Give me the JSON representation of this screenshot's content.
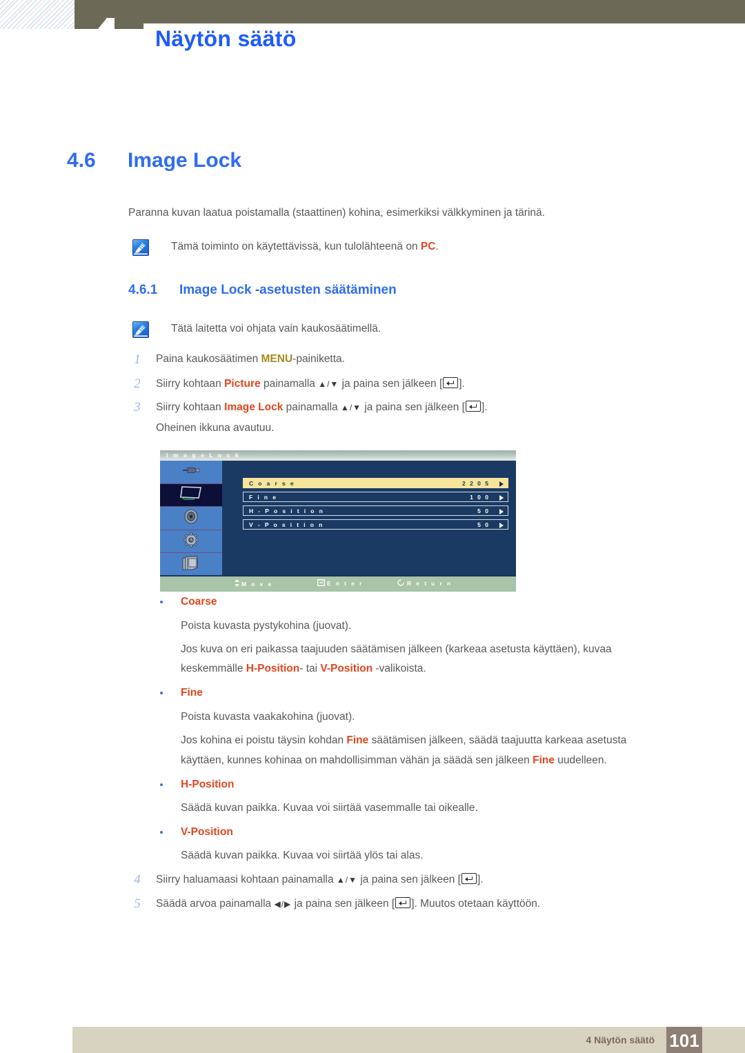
{
  "header": {
    "chapter_number": "4",
    "chapter_title": "Näytön säätö"
  },
  "section": {
    "number": "4.6",
    "title": "Image Lock",
    "intro": "Paranna kuvan laatua poistamalla (staattinen) kohina, esimerkiksi välkkyminen ja tärinä.",
    "note": {
      "icon": "note-pen-icon",
      "text_before": "Tämä toiminto on käytettävissä, kun tulolähteenä on ",
      "highlight": "PC",
      "text_after": "."
    }
  },
  "subsection": {
    "number": "4.6.1",
    "title": "Image Lock -asetusten säätäminen",
    "note": {
      "icon": "note-pen-icon",
      "text": "Tätä laitetta voi ohjata vain kaukosäätimellä."
    }
  },
  "steps_before": [
    {
      "n": "1",
      "parts": [
        {
          "t": "Paina kaukosäätimen ",
          "style": "plain"
        },
        {
          "t": "MENU",
          "style": "mustard"
        },
        {
          "t": "-painiketta.",
          "style": "plain"
        }
      ]
    },
    {
      "n": "2",
      "parts": [
        {
          "t": "Siirry kohtaan ",
          "style": "plain"
        },
        {
          "t": "Picture",
          "style": "orange"
        },
        {
          "t": " painamalla ",
          "style": "plain"
        },
        {
          "t": "▲/▼",
          "style": "arrows"
        },
        {
          "t": " ja paina sen jälkeen [",
          "style": "plain"
        },
        {
          "t": "enter-key-icon",
          "style": "enterkey"
        },
        {
          "t": "].",
          "style": "plain"
        }
      ]
    },
    {
      "n": "3",
      "parts": [
        {
          "t": "Siirry kohtaan ",
          "style": "plain"
        },
        {
          "t": "Image Lock",
          "style": "orange"
        },
        {
          "t": " painamalla ",
          "style": "plain"
        },
        {
          "t": "▲/▼",
          "style": "arrows"
        },
        {
          "t": " ja paina sen jälkeen [",
          "style": "plain"
        },
        {
          "t": "enter-key-icon",
          "style": "enterkey"
        },
        {
          "t": "].",
          "style": "plain"
        }
      ]
    }
  ],
  "step3_followup": "Oheinen ikkuna avautuu.",
  "osd": {
    "title": "I m a g e   L o c k",
    "sidebar_icons": [
      "input-connector-icon",
      "monitor-screen-icon",
      "speaker-icon",
      "gear-setup-icon",
      "multi-screen-icon"
    ],
    "selected_sidebar_index": 1,
    "rows": [
      {
        "label": "C o a r s e",
        "value": "2 2 0 5",
        "highlighted": true
      },
      {
        "label": "F i n e",
        "value": "1 0 0",
        "highlighted": false
      },
      {
        "label": "H - P o s i t i o n",
        "value": "5 0",
        "highlighted": false
      },
      {
        "label": "V - P o s i t i o n",
        "value": "5 0",
        "highlighted": false
      }
    ],
    "footer_items": [
      {
        "icon": "up-down-arrow-icon",
        "label": "M o v e"
      },
      {
        "icon": "enter-key-icon",
        "label": "E n t e r"
      },
      {
        "icon": "return-circle-icon",
        "label": "R e t u r n"
      }
    ]
  },
  "bullets": [
    {
      "title": "Coarse",
      "lines": [
        [
          {
            "t": "Poista kuvasta pystykohina (juovat).",
            "style": "plain"
          }
        ],
        [
          {
            "t": "Jos kuva on eri paikassa taajuuden säätämisen jälkeen (karkeaa asetusta käyttäen), kuvaa",
            "style": "plain"
          }
        ],
        [
          {
            "t": "keskemmälle ",
            "style": "plain"
          },
          {
            "t": "H-Position",
            "style": "orange"
          },
          {
            "t": "- tai ",
            "style": "plain"
          },
          {
            "t": "V-Position",
            "style": "orange"
          },
          {
            "t": " -valikoista.",
            "style": "plain"
          }
        ]
      ]
    },
    {
      "title": "Fine",
      "lines": [
        [
          {
            "t": "Poista kuvasta vaakakohina (juovat).",
            "style": "plain"
          }
        ],
        [
          {
            "t": "Jos kohina ei poistu täysin kohdan ",
            "style": "plain"
          },
          {
            "t": "Fine",
            "style": "orange"
          },
          {
            "t": " säätämisen jälkeen, säädä taajuutta karkeaa asetusta",
            "style": "plain"
          }
        ],
        [
          {
            "t": "käyttäen, kunnes kohinaa on mahdollisimman vähän ja säädä sen jälkeen ",
            "style": "plain"
          },
          {
            "t": "Fine",
            "style": "orange"
          },
          {
            "t": " uudelleen.",
            "style": "plain"
          }
        ]
      ]
    },
    {
      "title": "H-Position",
      "lines": [
        [
          {
            "t": "Säädä kuvan paikka. Kuvaa voi siirtää vasemmalle tai oikealle.",
            "style": "plain"
          }
        ]
      ]
    },
    {
      "title": "V-Position",
      "lines": [
        [
          {
            "t": "Säädä kuvan paikka. Kuvaa voi siirtää ylös tai alas.",
            "style": "plain"
          }
        ]
      ]
    }
  ],
  "steps_after": [
    {
      "n": "4",
      "parts": [
        {
          "t": "Siirry haluamaasi kohtaan painamalla ",
          "style": "plain"
        },
        {
          "t": "▲/▼",
          "style": "arrows"
        },
        {
          "t": " ja paina sen jälkeen [",
          "style": "plain"
        },
        {
          "t": "enter-key-icon",
          "style": "enterkey"
        },
        {
          "t": "].",
          "style": "plain"
        }
      ]
    },
    {
      "n": "5",
      "parts": [
        {
          "t": "Säädä arvoa painamalla ",
          "style": "plain"
        },
        {
          "t": "◀/▶",
          "style": "arrows"
        },
        {
          "t": " ja paina sen jälkeen [",
          "style": "plain"
        },
        {
          "t": "enter-key-icon",
          "style": "enterkey"
        },
        {
          "t": "]. Muutos otetaan käyttöön.",
          "style": "plain"
        }
      ]
    }
  ],
  "footer": {
    "label": "4 Näytön säätö",
    "page": "101"
  },
  "colors": {
    "heading_blue": "#2f6df0",
    "accent_orange": "#e1461f",
    "accent_mustard": "#a08a1d",
    "olive_bar": "#6c6a56",
    "footer_bar": "#d8d2c0",
    "footer_page_box": "#8e7f74",
    "osd_background": "#1b3a63",
    "osd_highlight": "#f6e59a",
    "osd_sidebar": "#4a80c6",
    "osd_footbar": "#a9c4a8"
  }
}
